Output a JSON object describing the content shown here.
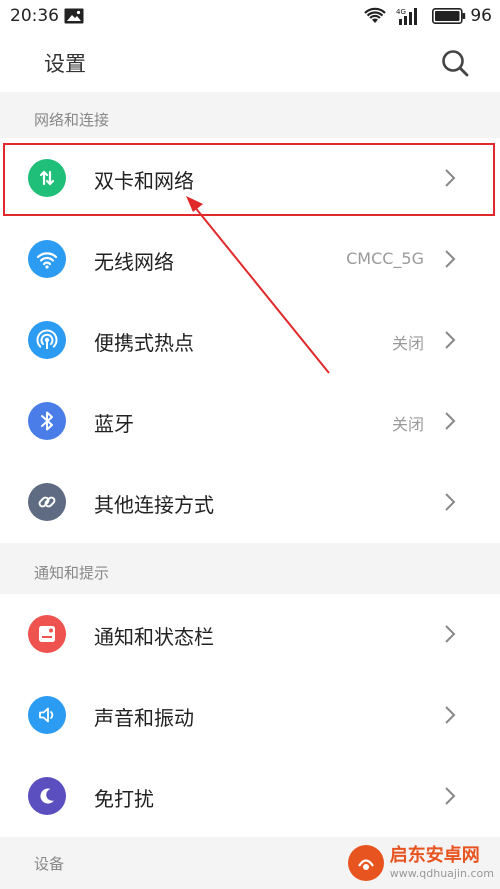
{
  "status_bar": {
    "time": "20:36",
    "battery": "96",
    "network_badge": "4G"
  },
  "header": {
    "title": "设置"
  },
  "sections": [
    {
      "label": "网络和连接",
      "items": [
        {
          "label": "双卡和网络",
          "value": "",
          "icon": "dual-sim-icon",
          "color": "#1fbf7a"
        },
        {
          "label": "无线网络",
          "value": "CMCC_5G",
          "icon": "wifi-icon",
          "color": "#2b9cf2"
        },
        {
          "label": "便携式热点",
          "value": "关闭",
          "icon": "hotspot-icon",
          "color": "#2b9cf2"
        },
        {
          "label": "蓝牙",
          "value": "关闭",
          "icon": "bluetooth-icon",
          "color": "#4a7de8"
        },
        {
          "label": "其他连接方式",
          "value": "",
          "icon": "link-icon",
          "color": "#5f6b82"
        }
      ]
    },
    {
      "label": "通知和提示",
      "items": [
        {
          "label": "通知和状态栏",
          "value": "",
          "icon": "notification-icon",
          "color": "#ef5350"
        },
        {
          "label": "声音和振动",
          "value": "",
          "icon": "sound-icon",
          "color": "#2b9cf2"
        },
        {
          "label": "免打扰",
          "value": "",
          "icon": "moon-icon",
          "color": "#5b4fbf"
        }
      ]
    },
    {
      "label": "设备"
    }
  ],
  "annotation_color": "#e0292a",
  "watermark": {
    "title": "启东安卓网",
    "url": "www.qdhuajin.com"
  }
}
